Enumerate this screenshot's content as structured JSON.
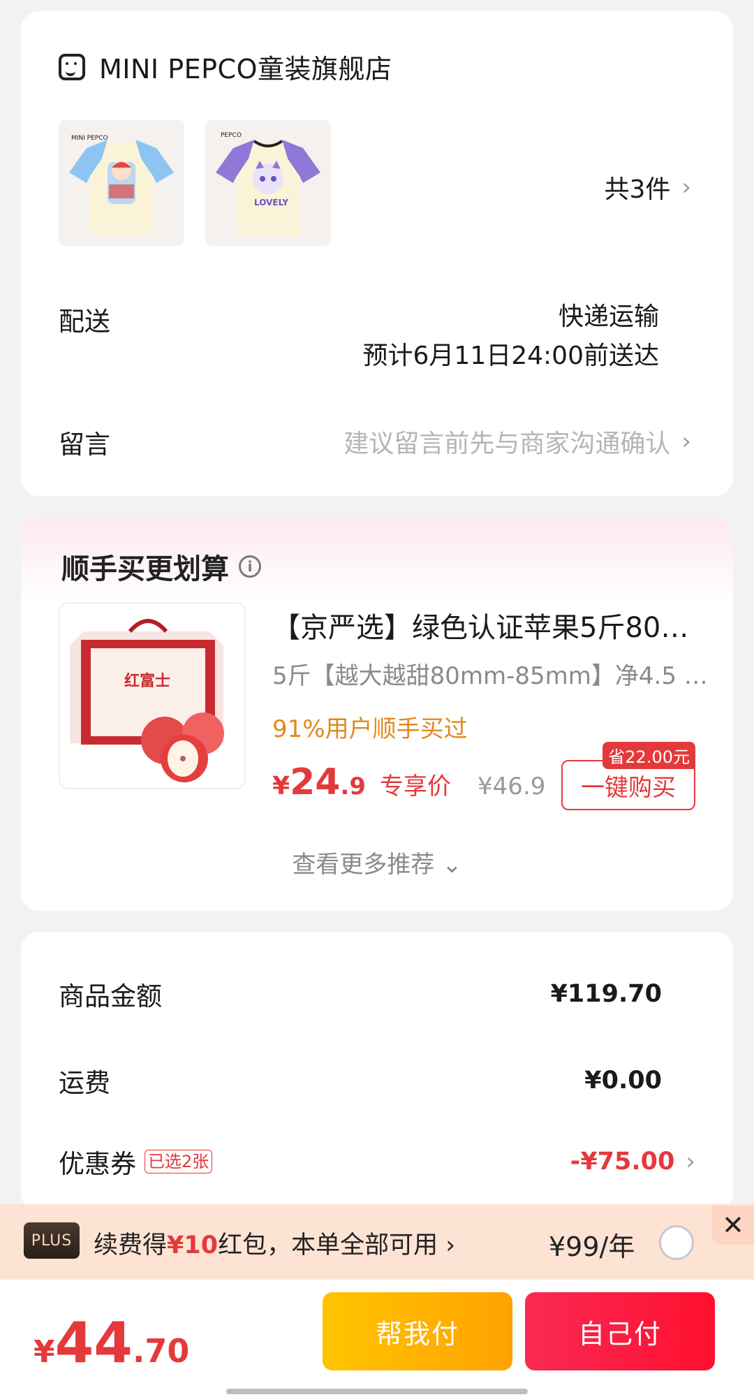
{
  "shop": {
    "name": "MINI PEPCO童装旗舰店",
    "item_count": "共3件",
    "delivery_label": "配送",
    "delivery_method": "快递运输",
    "delivery_eta": "预计6月11日24:00前送达",
    "message_label": "留言",
    "message_placeholder": "建议留言前先与商家沟通确认"
  },
  "recommend": {
    "title": "顺手买更划算",
    "product_title": "【京严选】绿色认证苹果5斤80…",
    "product_spec": "5斤【越大越甜80mm-85mm】净4.5 …",
    "social_proof": "91%用户顺手买过",
    "price_yen": "¥",
    "price_int": "24",
    "price_dec": ".9",
    "price_tag": "专享价",
    "price_original": "¥46.9",
    "save_badge": "省22.00元",
    "buy_button": "一键购买",
    "more": "查看更多推荐",
    "product_image_text": "红富士"
  },
  "amount": {
    "goods_label": "商品金额",
    "goods_value": "¥119.70",
    "shipping_label": "运费",
    "shipping_value": "¥0.00",
    "coupon_label": "优惠券",
    "coupon_badge": "已选2张",
    "coupon_value": "-¥75.00"
  },
  "plus": {
    "badge": "PLUS",
    "text_prefix": "续费得",
    "text_amount": "¥10",
    "text_suffix": "红包，本单全部可用",
    "price": "¥99/年"
  },
  "footer": {
    "total_yen": "¥",
    "total_int": "44",
    "total_dec": ".70",
    "help_pay": "帮我付",
    "self_pay": "自己付"
  },
  "colors": {
    "accent_red": "#e4393c",
    "social_orange": "#e08a1c",
    "help_btn": "#ffb300",
    "self_btn": "#ff1a3d"
  },
  "icons": [
    "shop-icon",
    "chevron-right-icon",
    "info-icon",
    "chevron-down-icon",
    "radio-icon",
    "close-icon"
  ]
}
